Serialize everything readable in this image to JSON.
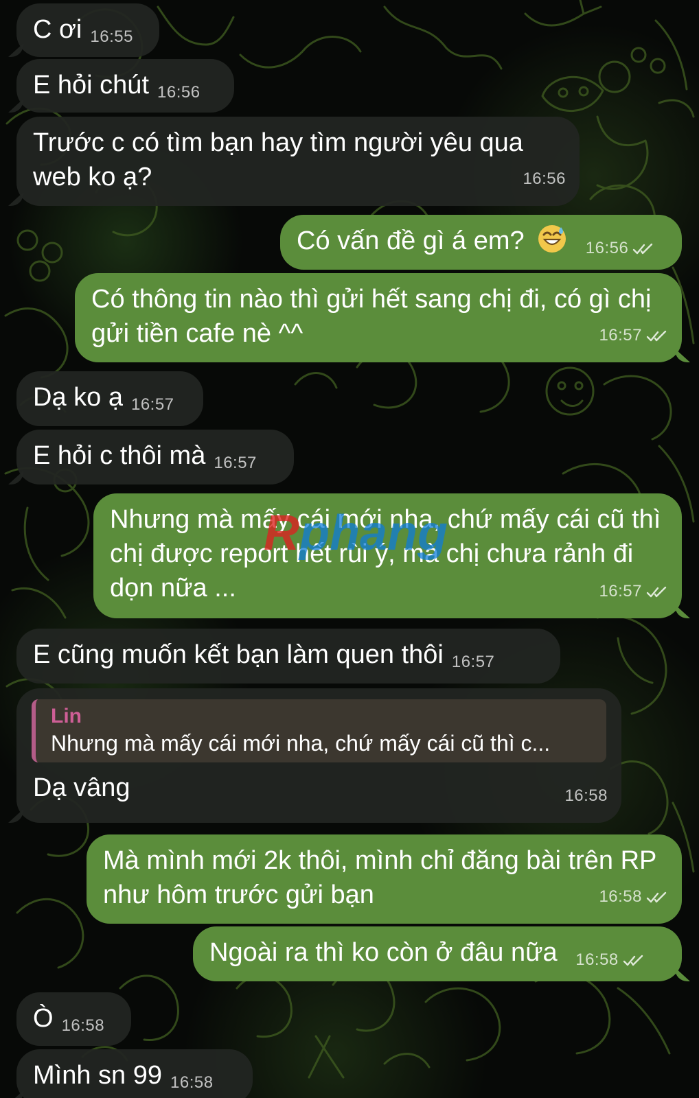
{
  "messages": [
    {
      "direction": "incoming",
      "text": "C ơi",
      "time": "16:55"
    },
    {
      "direction": "incoming",
      "text": "E hỏi chút",
      "time": "16:56"
    },
    {
      "direction": "incoming",
      "text": "Trước c có tìm bạn hay tìm người yêu qua web ko ạ?",
      "time": "16:56"
    },
    {
      "direction": "outgoing",
      "text": "Có vấn đề gì á em?",
      "emoji": "grinning-face-with-sweat-icon",
      "time": "16:56",
      "status": "double-check-icon"
    },
    {
      "direction": "outgoing",
      "text": "Có thông tin nào thì gửi hết sang chị đi, có gì chị gửi tiền cafe nè ^^",
      "time": "16:57",
      "status": "double-check-icon"
    },
    {
      "direction": "incoming",
      "text": "Dạ ko ạ",
      "time": "16:57"
    },
    {
      "direction": "incoming",
      "text": "E hỏi c thôi mà",
      "time": "16:57"
    },
    {
      "direction": "outgoing",
      "text": "Nhưng mà mấy cái mới nha, chứ mấy cái cũ thì chị được report hết rùi ý, mà chị chưa rảnh đi dọn nữa ...",
      "time": "16:57",
      "status": "double-check-icon"
    },
    {
      "direction": "incoming",
      "text": "E cũng muốn kết bạn làm quen thôi",
      "time": "16:57"
    },
    {
      "direction": "incoming",
      "reply_to": {
        "name": "Lin",
        "text": "Nhưng mà mấy cái mới nha, chứ mấy cái cũ thì c..."
      },
      "text": "Dạ vâng",
      "time": "16:58"
    },
    {
      "direction": "outgoing",
      "text": "Mà mình mới 2k thôi, mình chỉ đăng bài trên RP như hôm trước gửi bạn",
      "time": "16:58",
      "status": "double-check-icon"
    },
    {
      "direction": "outgoing",
      "text": "Ngoài ra thì ko còn ở đâu nữa",
      "time": "16:58",
      "status": "double-check-icon"
    },
    {
      "direction": "incoming",
      "text": "Ò",
      "time": "16:58"
    },
    {
      "direction": "incoming",
      "text": "Mình sn 99",
      "time": "16:58"
    }
  ],
  "watermark": {
    "accent": "R",
    "rest": "phang"
  },
  "colors": {
    "background": "#070907",
    "incoming_bubble": "#222522",
    "outgoing_bubble": "#5b8d3b",
    "reply_name": "#ce5f96"
  }
}
